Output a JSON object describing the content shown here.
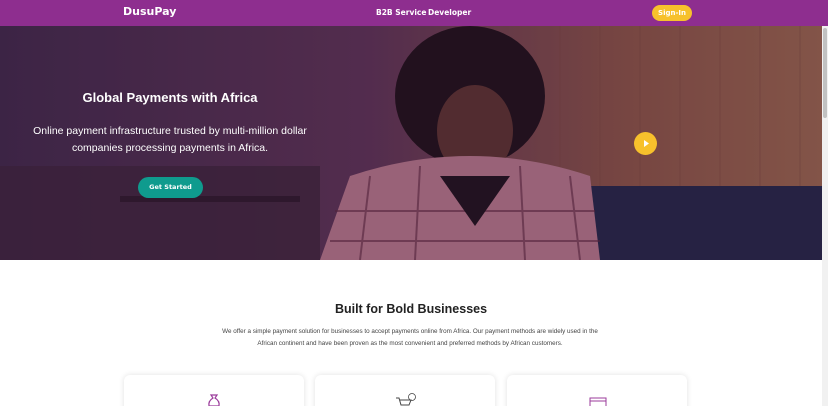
{
  "nav": {
    "brand": "DusuPay",
    "links": [
      "B2B Service",
      "Developer"
    ],
    "signin_label": "Sign-In"
  },
  "hero": {
    "title": "Global Payments with Africa",
    "subtitle": "Online payment infrastructure trusted by multi-million dollar companies processing payments in Africa.",
    "cta_label": "Get Started",
    "play_icon": "play-icon"
  },
  "section": {
    "title": "Built for Bold Businesses",
    "text": "We offer a simple payment solution for businesses to accept payments online from Africa. Our payment methods are widely used in the African continent and have been proven as  the most convenient and preferred methods by African customers."
  },
  "cards": [
    {
      "icon": "money-bag-icon"
    },
    {
      "icon": "cart-dollar-icon"
    },
    {
      "icon": "card-icon"
    }
  ],
  "colors": {
    "brand": "#8e2e8f",
    "accent": "#f7c12c",
    "cta": "#0f9b8e"
  }
}
